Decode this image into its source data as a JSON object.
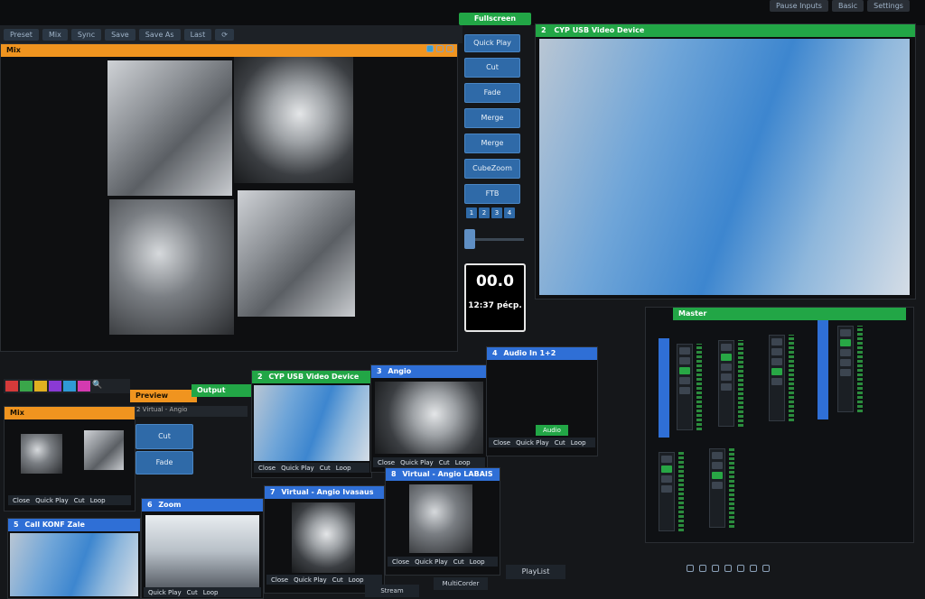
{
  "menubar": {
    "items": [
      "Preset",
      "Mix",
      "Sync",
      "Save",
      "Save As",
      "Last"
    ],
    "right_items": [
      "Pause Inputs",
      "Basic",
      "Settings"
    ]
  },
  "preview_panel": {
    "title": "Mix"
  },
  "transitions": {
    "fullscreen": "Fullscreen",
    "buttons": [
      "Quick Play",
      "Cut",
      "Fade",
      "Merge",
      "Merge",
      "CubeZoom",
      "FTB"
    ],
    "numbers": [
      "1",
      "2",
      "3",
      "4"
    ],
    "timer": "00.0",
    "clock": "12:37 pécp."
  },
  "output_panel": {
    "number": "2",
    "title": "CYP USB Video Device"
  },
  "bottom": {
    "preview_label": "Preview",
    "output_label": "Output",
    "preview_sublabel": "2 Virtual - Angio",
    "mini_buttons": [
      "Cut",
      "Fade"
    ],
    "mix_label": "Mix",
    "inputs": [
      {
        "number": "2",
        "title": "CYP USB Video Device"
      },
      {
        "number": "3",
        "title": "Angio"
      },
      {
        "number": "4",
        "title": "Audio In 1+2"
      },
      {
        "number": "5",
        "title": "Call KONF Zale"
      },
      {
        "number": "6",
        "title": "Zoom"
      },
      {
        "number": "7",
        "title": "Virtual - Angio Ivasaus"
      },
      {
        "number": "8",
        "title": "Virtual - Angio LABAIS"
      }
    ],
    "ctrl": {
      "close": "Close",
      "quick_play": "Quick Play",
      "cut": "Cut",
      "loop": "Loop",
      "audio": "Audio"
    },
    "playlist": "PlayList",
    "multicorder": "MultiCorder",
    "stream": "Stream"
  },
  "mixer": {
    "title": "Master"
  },
  "colors": {
    "orange": "#f0941f",
    "green": "#22a646",
    "blue": "#2f6fd6"
  }
}
